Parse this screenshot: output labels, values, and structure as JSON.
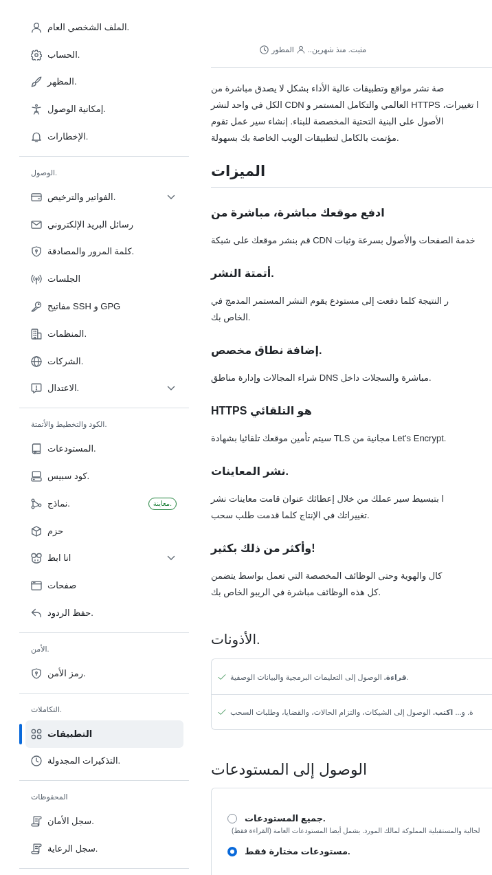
{
  "sidebar": {
    "groups": [
      {
        "items": [
          {
            "label": ".الملف الشخصي العام",
            "selected": false,
            "expandable": false
          },
          {
            "label": ".الحساب",
            "selected": false,
            "expandable": false
          },
          {
            "label": ".المظهر",
            "selected": false,
            "expandable": false
          },
          {
            "label": ".إمكانية الوصول",
            "selected": false,
            "expandable": false
          },
          {
            "label": ".الإخطارات",
            "selected": false,
            "expandable": false
          }
        ]
      },
      {
        "heading": ".الوصول",
        "items": [
          {
            "label": ".الفواتير والترخيص",
            "selected": false,
            "expandable": true
          },
          {
            "label": "رسائل البريد الإلكتروني",
            "selected": false,
            "expandable": false
          },
          {
            "label": ".كلمة المرور والمصادقة",
            "selected": false,
            "expandable": false
          },
          {
            "label": "الجلسات",
            "selected": false,
            "expandable": false
          },
          {
            "label": "GPG و SSH مفاتيح",
            "selected": false,
            "expandable": false
          },
          {
            "label": ".المنظمات",
            "selected": false,
            "expandable": false
          },
          {
            "label": ".الشركات",
            "selected": false,
            "expandable": false
          },
          {
            "label": ".الاعتدال",
            "selected": false,
            "expandable": true
          }
        ]
      },
      {
        "heading": ".الكود والتخطيط والأتمتة",
        "items": [
          {
            "label": ".المستودعات",
            "selected": false,
            "expandable": false
          },
          {
            "label": ".كود سبيس",
            "selected": false,
            "expandable": false
          },
          {
            "label": ".نماذج",
            "badge": ".معاينة",
            "selected": false,
            "expandable": false
          },
          {
            "label": "حزم",
            "selected": false,
            "expandable": false
          },
          {
            "label": "انا ابط",
            "selected": false,
            "expandable": true
          },
          {
            "label": "صفحات",
            "selected": false,
            "expandable": false
          },
          {
            "label": ".حفظ الردود",
            "selected": false,
            "expandable": false
          }
        ]
      },
      {
        "heading": ".الأمن",
        "items": [
          {
            "label": ".رمز الأمن",
            "selected": false,
            "expandable": false
          }
        ]
      },
      {
        "heading": ".التكاملات",
        "items": [
          {
            "label": "التطبيقات",
            "selected": true,
            "expandable": false
          },
          {
            "label": ".التذكيرات المجدولة",
            "selected": false,
            "expandable": false
          }
        ]
      },
      {
        "heading": "المحفوظات",
        "items": [
          {
            "label": ".سجل الأمان",
            "selected": false,
            "expandable": false
          },
          {
            "label": ".سجل الرعاية",
            "selected": false,
            "expandable": false
          }
        ]
      }
    ]
  },
  "app": {
    "author": "المطور",
    "installed": "مثبت. منذ شهرين..",
    "description": [
      "صة نشر مواقع وتطبيقات عالية الأداء بشكل لا يصدق مباشرة من",
      "ا تغييرات، HTTPS العالمي والتكامل المستمر و CDN الكل في واحد لنشر",
      "الأصول على البنية التحتية المخصصة للبناء. إنشاء سير عمل تقوم",
      ".مؤتمت بالكامل لتطبيقات الويب الخاصة بك بسهولة"
    ]
  },
  "features": {
    "title": "الميزات",
    "items": [
      {
        "title": "ادفع موقعك مباشرة، مباشرة من",
        "lines": [
          "خدمة الصفحات والأصول بسرعة وثبات CDN قم بنشر موقعك على شبكة"
        ]
      },
      {
        "title": ".أتمتة النشر",
        "lines": [
          "ر النتيجة كلما دفعت إلى مستودع يقوم النشر المستمر المدمج في",
          ".الخاص بك"
        ]
      },
      {
        "title": ".إضافة نطاق مخصص",
        "lines": [
          ".مباشرة والسجلات داخل DNS شراء المجالات وإدارة مناطق"
        ]
      },
      {
        "title": "هو التلقائي HTTPS",
        "lines": [
          ".Let's Encrypt مجانية من TLS سيتم تأمين موقعك تلقائيا بشهادة"
        ]
      },
      {
        "title": ".نشر المعاينات",
        "lines": [
          "ا بتبسيط سير عملك من خلال إعطائك عنوان قامت معاينات نشر",
          ".تغييراتك في الإنتاج كلما قدمت طلب سحب"
        ]
      },
      {
        "title": "!وأكثر من ذلك بكثير",
        "lines": [
          "كال والهوية وحتى الوظائف المخصصة التي تعمل بواسط يتضمن",
          ".كل هذه الوظائف مباشرة في الريبو الخاص بك"
        ]
      }
    ]
  },
  "permissions": {
    "title": ".الأذونات",
    "items": [
      {
        "text": ".**قراءة.** الوصول إلى التعليمات البرمجية والبيانات الوصفية"
      },
      {
        "text": "ة. و... **اكتب.** الوصول إلى الشيكات، والتزام الحالات، والقضايا، وطلبات السحب"
      }
    ]
  },
  "repository_access": {
    "title": "الوصول إلى المستودعات",
    "options": [
      {
        "label": ".جميع المستودعات",
        "description": "لحالية والمستقبلية المملوكة لمالك المورد. يشمل أيضا المستودعات العامة (القراءة فقط)",
        "selected": false
      },
      {
        "label": ".مستودعات مختارة فقط",
        "selected": true
      }
    ]
  }
}
